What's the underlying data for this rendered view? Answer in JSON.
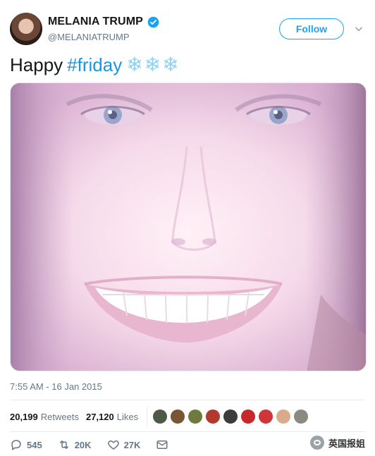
{
  "user": {
    "display_name": "MELANIA TRUMP",
    "handle": "@MELANIATRUMP",
    "verified_icon": "verified-badge-icon"
  },
  "follow_button": {
    "label": "Follow"
  },
  "tweet": {
    "text_plain": "Happy ",
    "hashtag": "#friday",
    "emoji": "❄❄❄"
  },
  "timestamp": "7:55 AM - 16 Jan 2015",
  "stats": {
    "retweets_count": "20,199",
    "retweets_label": "Retweets",
    "likes_count": "27,120",
    "likes_label": "Likes"
  },
  "actions": {
    "reply_count": "545",
    "retweet_count": "20K",
    "like_count": "27K"
  },
  "watermark": {
    "text": "英国报姐"
  },
  "colors": {
    "accent": "#1da1f2",
    "hashtag": "#1b95e0",
    "muted": "#657786"
  }
}
